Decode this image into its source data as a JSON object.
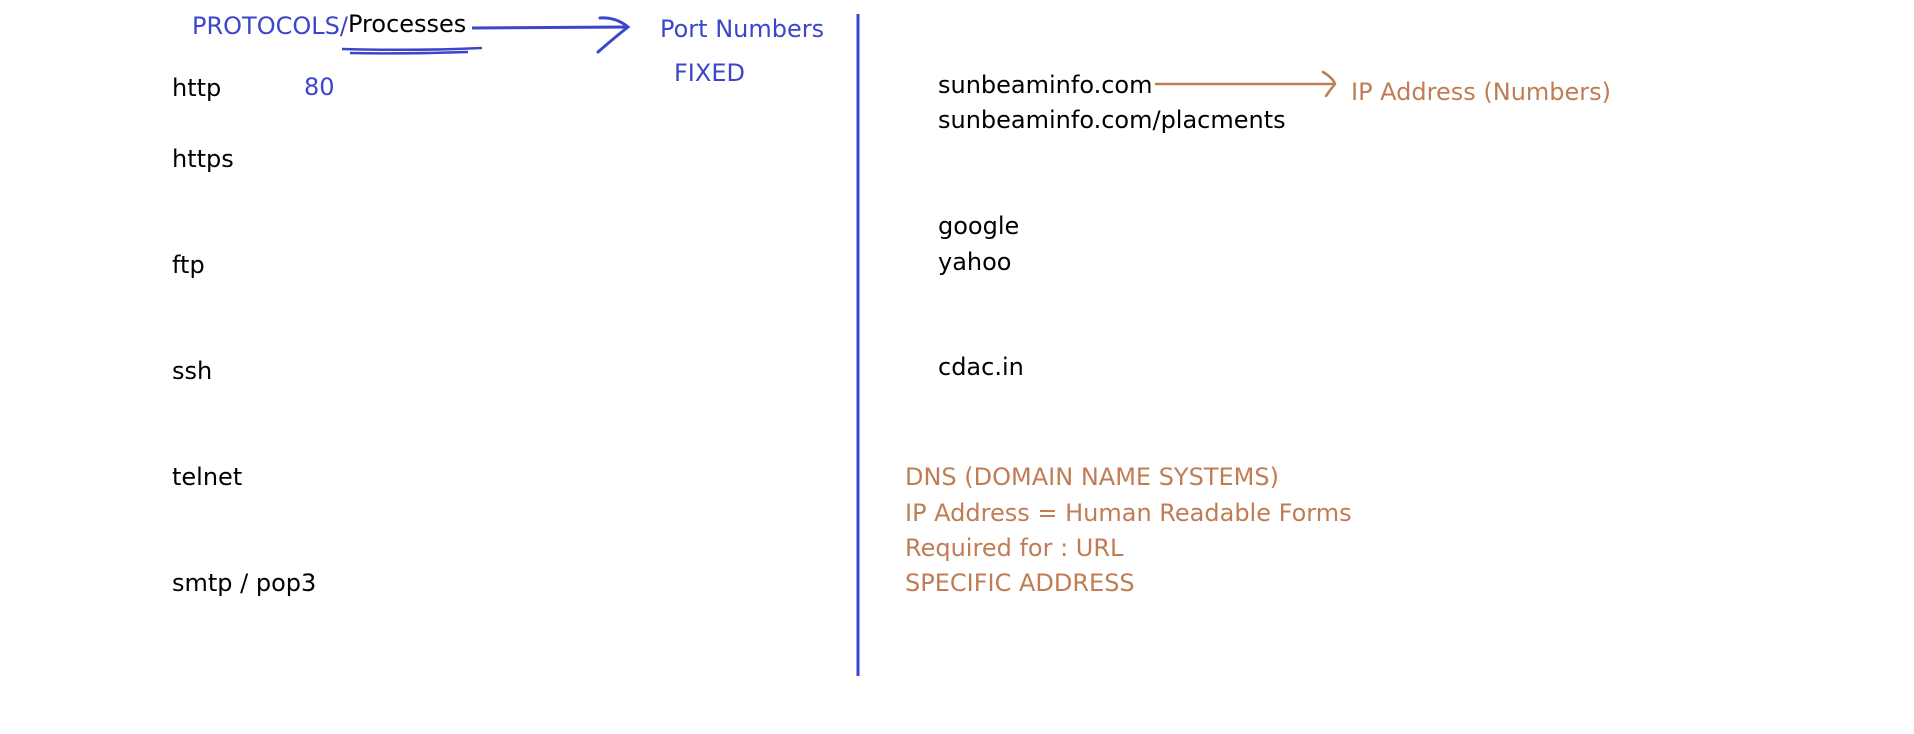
{
  "header": {
    "protocols_label": "PROTOCOLS/",
    "processes_label": "Processes",
    "port_numbers_label": "Port Numbers",
    "fixed_label": "FIXED"
  },
  "protocols": [
    {
      "name": "http",
      "port": "80"
    },
    {
      "name": "https",
      "port": ""
    },
    {
      "name": "ftp",
      "port": ""
    },
    {
      "name": "ssh",
      "port": ""
    },
    {
      "name": "telnet",
      "port": ""
    },
    {
      "name": "smtp / pop3",
      "port": ""
    }
  ],
  "domains": {
    "sunbeam": "sunbeaminfo.com",
    "sunbeam_placements": "sunbeaminfo.com/placments",
    "ip_address_numbers": "IP Address (Numbers)",
    "google": "google",
    "yahoo": "yahoo",
    "cdac": "cdac.in"
  },
  "dns_notes": [
    "DNS (DOMAIN NAME SYSTEMS)",
    "IP Address = Human Readable Forms",
    "Required for  : URL",
    "SPECIFIC ADDRESS"
  ],
  "colors": {
    "blue_ink": "#3b46c9",
    "brown_ink": "#c07d55",
    "black_ink": "#000000"
  }
}
